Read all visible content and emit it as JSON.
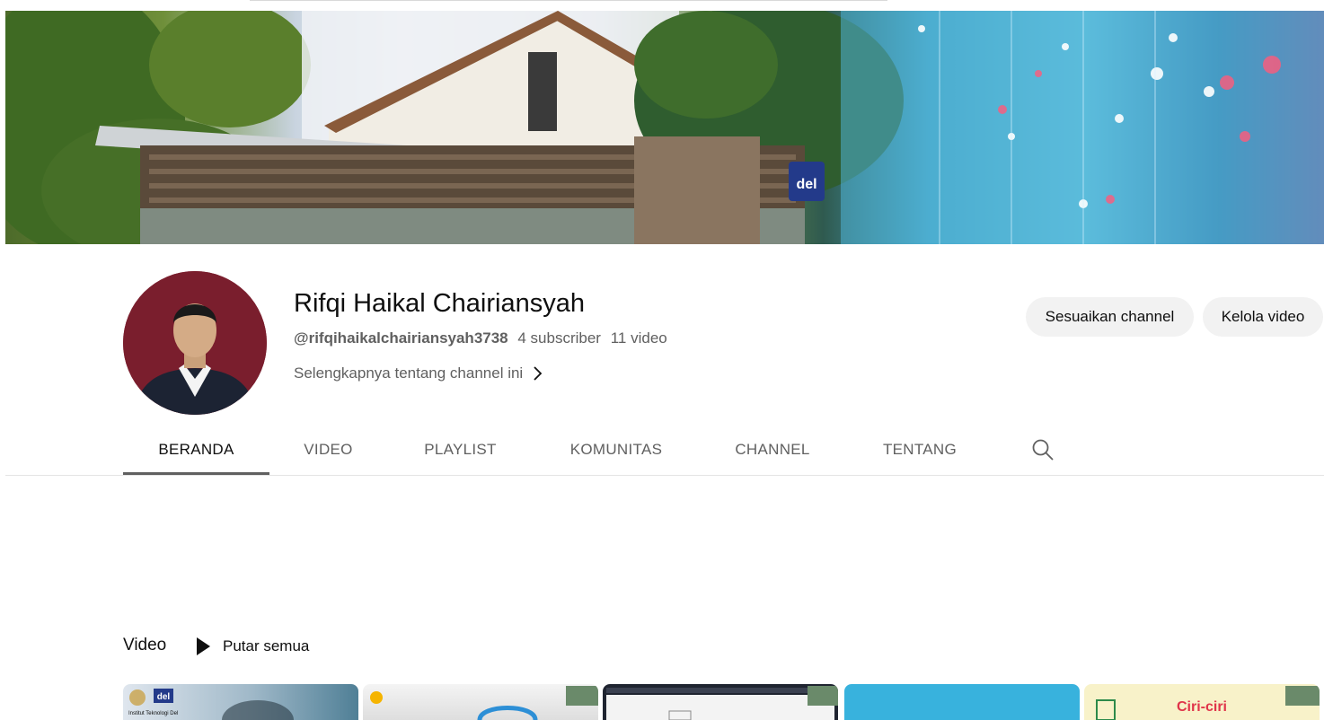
{
  "channel": {
    "name": "Rifqi Haikal Chairiansyah",
    "handle": "@rifqihaikalchairiansyah3738",
    "subscribers": "4 subscriber",
    "videos": "11 video",
    "more_link": "Selengkapnya tentang channel ini"
  },
  "actions": {
    "customize": "Sesuaikan channel",
    "manage": "Kelola video"
  },
  "tabs": [
    {
      "label": "BERANDA",
      "active": true
    },
    {
      "label": "VIDEO",
      "active": false
    },
    {
      "label": "PLAYLIST",
      "active": false
    },
    {
      "label": "KOMUNITAS",
      "active": false
    },
    {
      "label": "CHANNEL",
      "active": false
    },
    {
      "label": "TENTANG",
      "active": false
    }
  ],
  "icons": {
    "search": "search-icon",
    "chevron": "chevron-right-icon",
    "play": "play-icon"
  },
  "section": {
    "title": "Video",
    "play_all": "Putar semua"
  },
  "thumbnails": [
    {
      "text": "Institut Teknologi Del",
      "logo": "del"
    },
    {
      "text": ""
    },
    {
      "text": ""
    },
    {
      "text": ""
    },
    {
      "text": "Ciri-ciri"
    }
  ]
}
